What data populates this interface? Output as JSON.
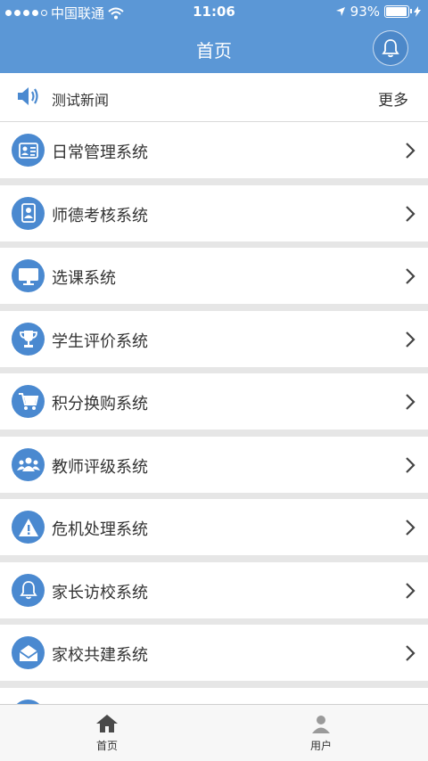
{
  "status": {
    "carrier": "中国联通",
    "time": "11:06",
    "battery": "93%"
  },
  "header": {
    "title": "首页"
  },
  "news": {
    "text": "测试新闻",
    "more": "更多"
  },
  "menu": [
    {
      "label": "日常管理系统",
      "icon": "id-card-icon"
    },
    {
      "label": "师德考核系统",
      "icon": "contact-book-icon"
    },
    {
      "label": "选课系统",
      "icon": "monitor-icon"
    },
    {
      "label": "学生评价系统",
      "icon": "trophy-icon"
    },
    {
      "label": "积分换购系统",
      "icon": "cart-icon"
    },
    {
      "label": "教师评级系统",
      "icon": "group-icon"
    },
    {
      "label": "危机处理系统",
      "icon": "warning-icon"
    },
    {
      "label": "家长访校系统",
      "icon": "bell-icon"
    },
    {
      "label": "家校共建系统",
      "icon": "envelope-icon"
    }
  ],
  "tabbar": {
    "home": "首页",
    "user": "用户"
  },
  "colors": {
    "primary": "#5b97d6",
    "icon_bg": "#4a89d0"
  }
}
